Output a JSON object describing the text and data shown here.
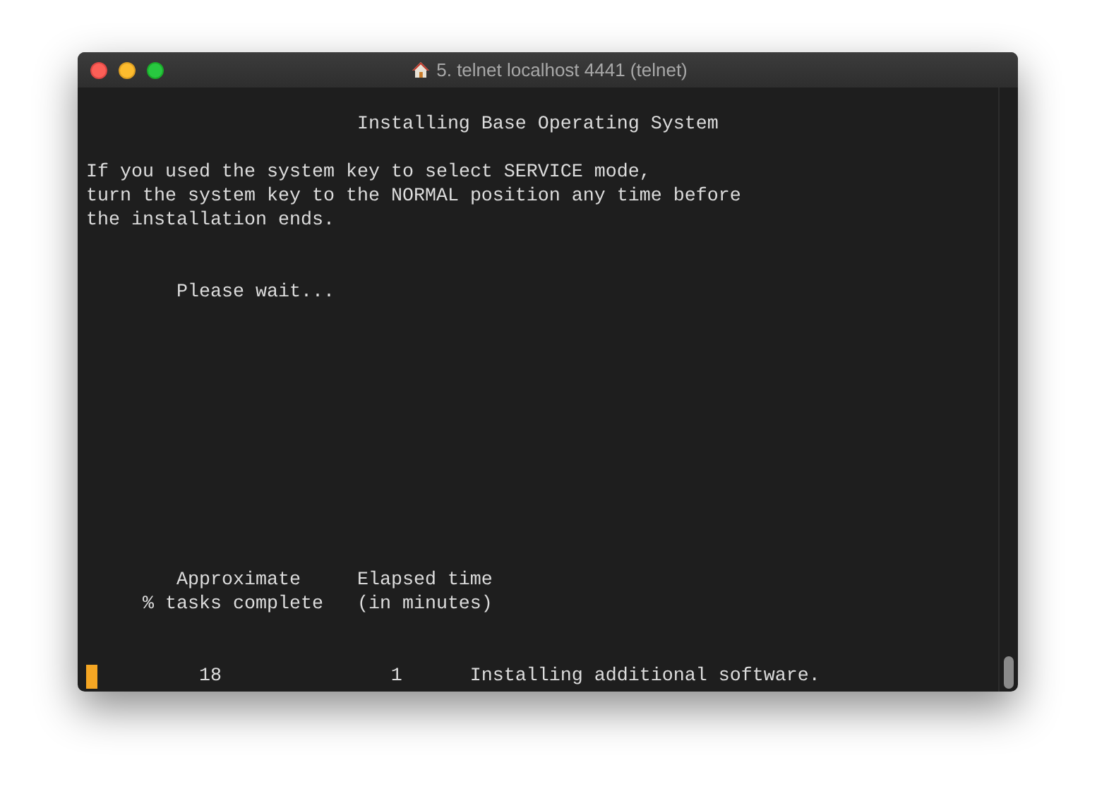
{
  "window": {
    "title": "5. telnet localhost 4441 (telnet)"
  },
  "screen": {
    "heading": "Installing Base Operating System",
    "notice": [
      "If you used the system key to select SERVICE mode,",
      "turn the system key to the NORMAL position any time before",
      "the installation ends."
    ],
    "wait_message": "Please wait...",
    "columns": [
      {
        "header": [
          "Approximate",
          "% tasks complete"
        ]
      },
      {
        "header": [
          "Elapsed time",
          "(in minutes)"
        ]
      }
    ],
    "progress": {
      "percent": "18",
      "elapsed": "1",
      "status": "Installing additional software."
    }
  }
}
